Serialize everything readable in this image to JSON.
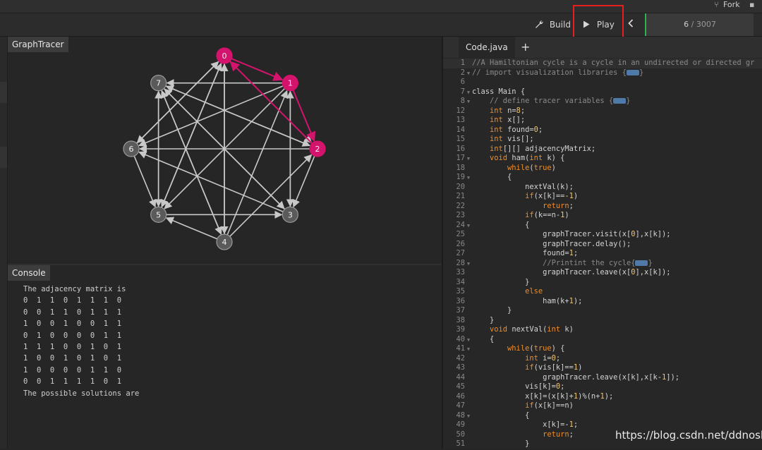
{
  "topbar": {
    "fork_label": "Fork"
  },
  "toolbar": {
    "build_label": "Build",
    "play_label": "Play",
    "prev_icon": "chevron-left-icon",
    "progress_current": "6",
    "progress_total": "/ 3007"
  },
  "graph_panel": {
    "title": "GraphTracer",
    "nodes": [
      {
        "id": "0",
        "label": "0",
        "highlighted": true
      },
      {
        "id": "1",
        "label": "1",
        "highlighted": true
      },
      {
        "id": "2",
        "label": "2",
        "highlighted": true
      },
      {
        "id": "3",
        "label": "3",
        "highlighted": false
      },
      {
        "id": "4",
        "label": "4",
        "highlighted": false
      },
      {
        "id": "5",
        "label": "5",
        "highlighted": false
      },
      {
        "id": "6",
        "label": "6",
        "highlighted": false
      },
      {
        "id": "7",
        "label": "7",
        "highlighted": false
      }
    ],
    "adjacency": [
      [
        0,
        1,
        1,
        0,
        1,
        1,
        1,
        0
      ],
      [
        0,
        0,
        1,
        1,
        0,
        1,
        1,
        1
      ],
      [
        1,
        0,
        0,
        1,
        0,
        0,
        1,
        1
      ],
      [
        0,
        1,
        0,
        0,
        0,
        0,
        1,
        1
      ],
      [
        1,
        1,
        1,
        0,
        0,
        1,
        0,
        1
      ],
      [
        1,
        0,
        0,
        1,
        0,
        1,
        0,
        1
      ],
      [
        1,
        0,
        0,
        0,
        0,
        1,
        1,
        0
      ],
      [
        0,
        0,
        1,
        1,
        1,
        1,
        0,
        1
      ]
    ],
    "highlighted_edges": [
      [
        0,
        1
      ],
      [
        1,
        2
      ],
      [
        2,
        0
      ]
    ],
    "colors": {
      "node": "#5a5a5a",
      "highlight": "#d4136d",
      "edge": "#c8c8c8"
    }
  },
  "console": {
    "title": "Console",
    "lines": [
      "The adjacency matrix is",
      "0  1  1  0  1  1  1  0",
      "0  0  1  1  0  1  1  1",
      "1  0  0  1  0  0  1  1",
      "0  1  0  0  0  0  1  1",
      "1  1  1  0  0  1  0  1",
      "1  0  0  1  0  1  0  1",
      "1  0  0  0  0  1  1  0",
      "0  0  1  1  1  1  0  1",
      "The possible solutions are"
    ]
  },
  "editor": {
    "tab_label": "Code.java",
    "add_tab": "+",
    "lines": [
      {
        "n": "1",
        "t": [
          [
            "c",
            "//A Hamiltonian cycle is a cycle in an undirected or directed gr"
          ]
        ]
      },
      {
        "n": "2",
        "fold": true,
        "t": [
          [
            "c",
            "// import visualization libraries {"
          ],
          [
            "f",
            ""
          ],
          [
            "c",
            "}"
          ]
        ]
      },
      {
        "n": "6",
        "t": []
      },
      {
        "n": "7",
        "fold": true,
        "t": [
          [
            "tx",
            "class Main {"
          ]
        ]
      },
      {
        "n": "8",
        "fold": true,
        "t": [
          [
            "c",
            "    // define tracer variables {"
          ],
          [
            "f",
            ""
          ],
          [
            "c",
            "}"
          ]
        ]
      },
      {
        "n": "12",
        "t": [
          [
            "tx",
            "    "
          ],
          [
            "k",
            "int"
          ],
          [
            "tx",
            " n="
          ],
          [
            "n",
            "8"
          ],
          [
            "tx",
            ";"
          ]
        ]
      },
      {
        "n": "13",
        "t": [
          [
            "tx",
            "    "
          ],
          [
            "k",
            "int"
          ],
          [
            "tx",
            " x[];"
          ]
        ]
      },
      {
        "n": "14",
        "t": [
          [
            "tx",
            "    "
          ],
          [
            "k",
            "int"
          ],
          [
            "tx",
            " found="
          ],
          [
            "n",
            "0"
          ],
          [
            "tx",
            ";"
          ]
        ]
      },
      {
        "n": "15",
        "t": [
          [
            "tx",
            "    "
          ],
          [
            "k",
            "int"
          ],
          [
            "tx",
            " vis[];"
          ]
        ]
      },
      {
        "n": "16",
        "t": [
          [
            "tx",
            "    "
          ],
          [
            "k",
            "int"
          ],
          [
            "tx",
            "[][] adjacencyMatrix;"
          ]
        ]
      },
      {
        "n": "17",
        "fold": true,
        "t": [
          [
            "tx",
            "    "
          ],
          [
            "k",
            "void"
          ],
          [
            "tx",
            " ham("
          ],
          [
            "k",
            "int"
          ],
          [
            "tx",
            " k) {"
          ]
        ]
      },
      {
        "n": "18",
        "t": [
          [
            "tx",
            "        "
          ],
          [
            "k",
            "while"
          ],
          [
            "tx",
            "("
          ],
          [
            "k",
            "true"
          ],
          [
            "tx",
            ")"
          ]
        ]
      },
      {
        "n": "19",
        "fold": true,
        "t": [
          [
            "tx",
            "        {"
          ]
        ]
      },
      {
        "n": "20",
        "t": [
          [
            "tx",
            "            nextVal(k);"
          ]
        ]
      },
      {
        "n": "21",
        "t": [
          [
            "tx",
            "            "
          ],
          [
            "k",
            "if"
          ],
          [
            "tx",
            "(x[k]=="
          ],
          [
            "n",
            "-1"
          ],
          [
            "tx",
            ")"
          ]
        ]
      },
      {
        "n": "22",
        "t": [
          [
            "tx",
            "                "
          ],
          [
            "k",
            "return"
          ],
          [
            "tx",
            ";"
          ]
        ]
      },
      {
        "n": "23",
        "t": [
          [
            "tx",
            "            "
          ],
          [
            "k",
            "if"
          ],
          [
            "tx",
            "(k==n-"
          ],
          [
            "n",
            "1"
          ],
          [
            "tx",
            ")"
          ]
        ]
      },
      {
        "n": "24",
        "fold": true,
        "t": [
          [
            "tx",
            "            {"
          ]
        ]
      },
      {
        "n": "25",
        "t": [
          [
            "tx",
            "                graphTracer.visit(x["
          ],
          [
            "n",
            "0"
          ],
          [
            "tx",
            "],x[k]);"
          ]
        ]
      },
      {
        "n": "26",
        "t": [
          [
            "tx",
            "                graphTracer.delay();"
          ]
        ]
      },
      {
        "n": "27",
        "t": [
          [
            "tx",
            "                found="
          ],
          [
            "n",
            "1"
          ],
          [
            "tx",
            ";"
          ]
        ]
      },
      {
        "n": "28",
        "fold": true,
        "t": [
          [
            "c",
            "                //Printint the cycle{"
          ],
          [
            "f",
            ""
          ],
          [
            "c",
            "}"
          ]
        ]
      },
      {
        "n": "33",
        "t": [
          [
            "tx",
            "                graphTracer.leave(x["
          ],
          [
            "n",
            "0"
          ],
          [
            "tx",
            "],x[k]);"
          ]
        ]
      },
      {
        "n": "34",
        "t": [
          [
            "tx",
            "            }"
          ]
        ]
      },
      {
        "n": "35",
        "t": [
          [
            "tx",
            "            "
          ],
          [
            "k",
            "else"
          ]
        ]
      },
      {
        "n": "36",
        "t": [
          [
            "tx",
            "                ham(k+"
          ],
          [
            "n",
            "1"
          ],
          [
            "tx",
            ");"
          ]
        ]
      },
      {
        "n": "37",
        "t": [
          [
            "tx",
            "        }"
          ]
        ]
      },
      {
        "n": "38",
        "t": [
          [
            "tx",
            "    }"
          ]
        ]
      },
      {
        "n": "39",
        "t": [
          [
            "tx",
            "    "
          ],
          [
            "k",
            "void"
          ],
          [
            "tx",
            " nextVal("
          ],
          [
            "k",
            "int"
          ],
          [
            "tx",
            " k)"
          ]
        ]
      },
      {
        "n": "40",
        "fold": true,
        "t": [
          [
            "tx",
            "    {"
          ]
        ]
      },
      {
        "n": "41",
        "fold": true,
        "t": [
          [
            "tx",
            "        "
          ],
          [
            "k",
            "while"
          ],
          [
            "tx",
            "("
          ],
          [
            "k",
            "true"
          ],
          [
            "tx",
            ") {"
          ]
        ]
      },
      {
        "n": "42",
        "t": [
          [
            "tx",
            "            "
          ],
          [
            "k",
            "int"
          ],
          [
            "tx",
            " i="
          ],
          [
            "n",
            "0"
          ],
          [
            "tx",
            ";"
          ]
        ]
      },
      {
        "n": "43",
        "t": [
          [
            "tx",
            "            "
          ],
          [
            "k",
            "if"
          ],
          [
            "tx",
            "(vis[k]=="
          ],
          [
            "n",
            "1"
          ],
          [
            "tx",
            ")"
          ]
        ]
      },
      {
        "n": "44",
        "t": [
          [
            "tx",
            "                graphTracer.leave(x[k],x[k-"
          ],
          [
            "n",
            "1"
          ],
          [
            "tx",
            "]);"
          ]
        ]
      },
      {
        "n": "45",
        "t": [
          [
            "tx",
            "            vis[k]="
          ],
          [
            "n",
            "0"
          ],
          [
            "tx",
            ";"
          ]
        ]
      },
      {
        "n": "46",
        "t": [
          [
            "tx",
            "            x[k]=(x[k]+"
          ],
          [
            "n",
            "1"
          ],
          [
            "tx",
            ")%(n+"
          ],
          [
            "n",
            "1"
          ],
          [
            "tx",
            ");"
          ]
        ]
      },
      {
        "n": "47",
        "t": [
          [
            "tx",
            "            "
          ],
          [
            "k",
            "if"
          ],
          [
            "tx",
            "(x[k]==n)"
          ]
        ]
      },
      {
        "n": "48",
        "fold": true,
        "t": [
          [
            "tx",
            "            {"
          ]
        ]
      },
      {
        "n": "49",
        "t": [
          [
            "tx",
            "                x[k]=-"
          ],
          [
            "n",
            "1"
          ],
          [
            "tx",
            ";"
          ]
        ]
      },
      {
        "n": "50",
        "t": [
          [
            "tx",
            "                "
          ],
          [
            "k",
            "return"
          ],
          [
            "tx",
            ";"
          ]
        ]
      },
      {
        "n": "51",
        "t": [
          [
            "tx",
            "            }"
          ]
        ]
      }
    ]
  },
  "watermark": "https://blog.csdn.net/ddnosh"
}
